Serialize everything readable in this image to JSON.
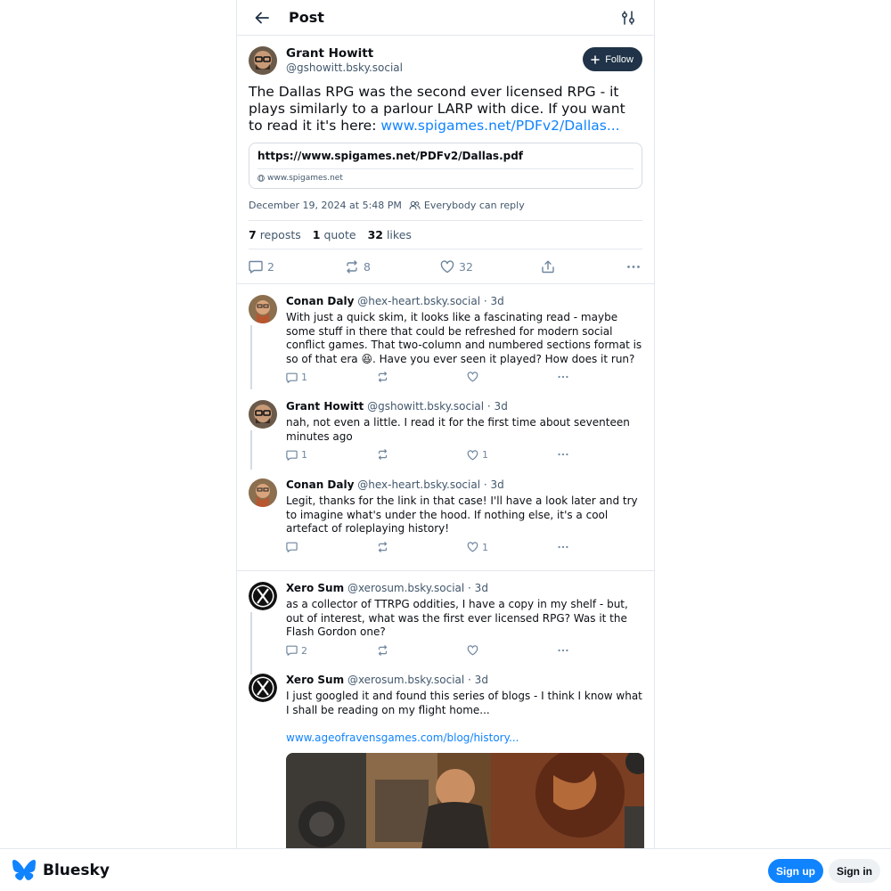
{
  "header": {
    "title": "Post"
  },
  "post": {
    "author_name": "Grant Howitt",
    "author_handle": "@gshowitt.bsky.social",
    "follow_label": "Follow",
    "text": "The Dallas RPG was the second ever licensed RPG - it plays similarly to a parlour LARP with dice. If you want to read it it's here: ",
    "link_text": "www.spigames.net/PDFv2/Dallas...",
    "card_title": "https://www.spigames.net/PDFv2/Dallas.pdf",
    "card_domain": "www.spigames.net",
    "timestamp": "December 19, 2024 at 5:48 PM",
    "reply_setting": "Everybody can reply",
    "stats": {
      "reposts_count": "7",
      "reposts_label": "reposts",
      "quotes_count": "1",
      "quotes_label": "quote",
      "likes_count": "32",
      "likes_label": "likes"
    },
    "actions": {
      "replies": "2",
      "reposts": "8",
      "likes": "32"
    }
  },
  "thread1": [
    {
      "name": "Conan Daly",
      "handle": "@hex-heart.bsky.social",
      "age": " · 3d",
      "text": "With just a quick skim, it looks like a fascinating read - maybe some stuff in there that could be refreshed for modern social conflict games. That two-column and numbered sections format is so of that era 😆. Have you ever seen it played? How does it run?",
      "replies": "1",
      "likes": ""
    },
    {
      "name": "Grant Howitt",
      "handle": "@gshowitt.bsky.social",
      "age": " · 3d",
      "text": "nah, not even a little. I read it for the first time about seventeen minutes ago",
      "replies": "1",
      "likes": "1"
    },
    {
      "name": "Conan Daly",
      "handle": "@hex-heart.bsky.social",
      "age": " · 3d",
      "text": "Legit, thanks for the link in that case! I'll have a look later and try to imagine what's under the hood. If nothing else, it's a cool artefact of roleplaying history!",
      "replies": "",
      "likes": "1"
    }
  ],
  "thread2": [
    {
      "name": "Xero Sum",
      "handle": "@xerosum.bsky.social",
      "age": " · 3d",
      "text": "as a collector of TTRPG oddities, I have a copy in my shelf - but, out of interest, what was the first ever licensed RPG? Was it the Flash Gordon one?",
      "replies": "2",
      "likes": ""
    },
    {
      "name": "Xero Sum",
      "handle": "@xerosum.bsky.social",
      "age": " · 3d",
      "text": "I just googled it and found this series of blogs - I think I know what I shall be reading on my flight home...",
      "link": "www.ageofravensgames.com/blog/history..."
    }
  ],
  "footer": {
    "brand": "Bluesky",
    "signup": "Sign up",
    "signin": "Sign in"
  },
  "colors": {
    "accent": "#1083fe",
    "follow_bg": "#203348",
    "muted": "#42576c"
  }
}
